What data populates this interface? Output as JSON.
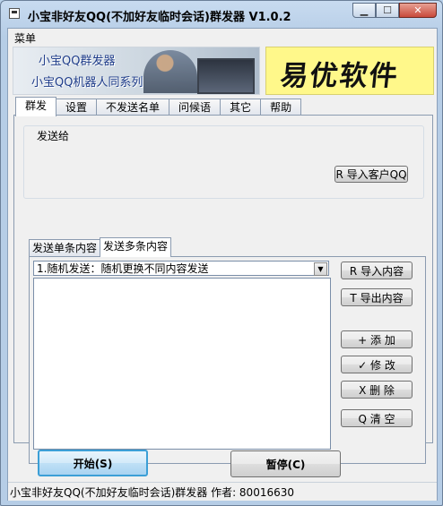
{
  "window": {
    "title": "小宝非好友QQ(不加好友临时会话)群发器 V1.0.2"
  },
  "caption_buttons": {
    "minimize": "▁",
    "maximize": "☐",
    "close": "✕"
  },
  "menu": {
    "items": [
      "菜单"
    ]
  },
  "banner": {
    "line1": "小宝QQ群发器",
    "line2": "小宝QQ机器人同系列",
    "logo": "易优软件"
  },
  "tabs": [
    {
      "label": "群发",
      "active": true
    },
    {
      "label": "设置",
      "active": false
    },
    {
      "label": "不发送名单",
      "active": false
    },
    {
      "label": "问候语",
      "active": false
    },
    {
      "label": "其它",
      "active": false
    },
    {
      "label": "帮助",
      "active": false
    }
  ],
  "send_to": {
    "label": "发送给",
    "import_button": "R 导入客户QQ"
  },
  "sub_tabs": [
    {
      "label": "发送单条内容",
      "active": false
    },
    {
      "label": "发送多条内容",
      "active": true
    }
  ],
  "mode_select": {
    "value": "1.随机发送：随机更换不同内容发送"
  },
  "content_buttons": {
    "import": "R 导入内容",
    "export": "T 导出内容",
    "add": "+ 添  加",
    "edit": "✓ 修  改",
    "delete": "X  删  除",
    "clear": "Q  清  空"
  },
  "actions": {
    "start": "开始(S)",
    "pause": "暂停(C)"
  },
  "status": {
    "text": "小宝非好友QQ(不加好友临时会话)群发器 作者: 80016630"
  }
}
